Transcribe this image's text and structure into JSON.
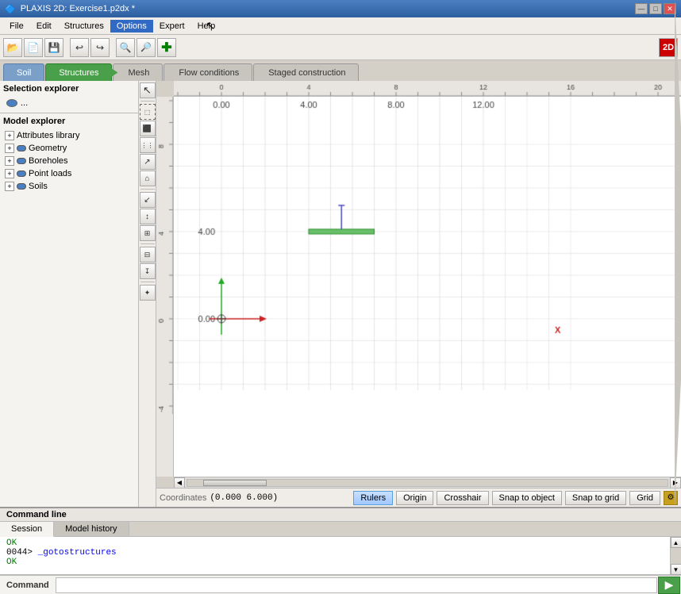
{
  "window": {
    "title": "PLAXIS 2D: Exercise1.p2dx *",
    "icon": "🔷"
  },
  "winButtons": {
    "minimize": "—",
    "maximize": "□",
    "close": "✕"
  },
  "menuBar": {
    "items": [
      "File",
      "Edit",
      "Structures",
      "Options",
      "Expert",
      "Help"
    ]
  },
  "toolbar": {
    "buttons": [
      "📁",
      "💾",
      "⟵",
      "⟶",
      "🔍",
      "🔍",
      "✚"
    ],
    "badge": "2D"
  },
  "stageTabs": [
    {
      "label": "Soil",
      "state": "soil"
    },
    {
      "label": "Structures",
      "state": "active"
    },
    {
      "label": "Mesh",
      "state": "inactive"
    },
    {
      "label": "Flow conditions",
      "state": "inactive"
    },
    {
      "label": "Staged construction",
      "state": "inactive"
    }
  ],
  "selectionExplorer": {
    "title": "Selection explorer",
    "items": [
      {
        "label": "..."
      }
    ]
  },
  "modelExplorer": {
    "title": "Model explorer",
    "items": [
      {
        "label": "Attributes library",
        "level": 0
      },
      {
        "label": "Geometry",
        "level": 0,
        "hasEye": true
      },
      {
        "label": "Boreholes",
        "level": 0,
        "hasEye": true
      },
      {
        "label": "Point loads",
        "level": 0,
        "hasEye": true
      },
      {
        "label": "Soils",
        "level": 0,
        "hasEye": true
      }
    ]
  },
  "canvas": {
    "xAxisLabel": "X",
    "yAxisValues": [
      "4.00",
      "0.00"
    ],
    "xAxisValues": [
      "0.00",
      "4.00",
      "8.00",
      "12.00"
    ]
  },
  "statusBar": {
    "coordsLabel": "Coordinates",
    "coordsValue": "(0.000 6.000)",
    "buttons": [
      "Rulers",
      "Origin",
      "Crosshair",
      "Snap to object",
      "Snap to grid",
      "Grid"
    ]
  },
  "commandArea": {
    "title": "Command line",
    "tabs": [
      "Session",
      "Model history"
    ],
    "activeTab": "Session",
    "output": [
      {
        "type": "ok",
        "text": "OK"
      },
      {
        "type": "prompt",
        "text": "0044>"
      },
      {
        "type": "cmd",
        "text": "_gotostructures"
      },
      {
        "type": "ok",
        "text": "OK"
      }
    ],
    "inputLabel": "Command",
    "runButton": "▶"
  }
}
